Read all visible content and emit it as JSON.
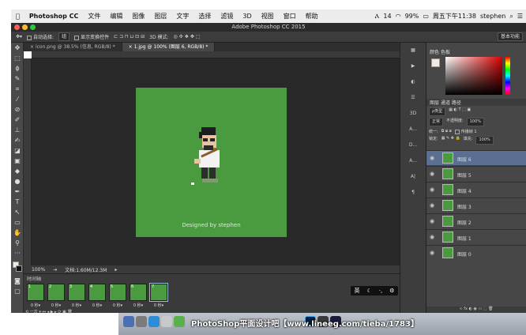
{
  "menubar": {
    "apple": "",
    "app": "Photoshop CC",
    "items": [
      "文件",
      "编辑",
      "图像",
      "图层",
      "文字",
      "选择",
      "滤镜",
      "3D",
      "视图",
      "窗口",
      "帮助"
    ],
    "status_a": "14",
    "battery": "99%",
    "clock": "周五下午11:38",
    "user": "stephen"
  },
  "titlebar": {
    "title": "Adobe Photoshop CC 2015"
  },
  "options": {
    "auto_select": "自动选择:",
    "auto_select_value": "组",
    "show_transform": "显示变换控件",
    "mode3d": "3D 模式:",
    "workspace": "基本功能"
  },
  "tabs": [
    {
      "label": "icon.png @ 38.5% (信息, RGB/8) *"
    },
    {
      "label": "1.jpg @ 100% (图层 6, RGB/8) *"
    }
  ],
  "canvas": {
    "credit": "Designed by stephen"
  },
  "status": {
    "zoom": "100%",
    "doc": "文档:1.60M/12.3M"
  },
  "timeline": {
    "title": "时间轴",
    "frames": [
      {
        "num": "1",
        "delay": "0 秒▾"
      },
      {
        "num": "2",
        "delay": "0 秒▾"
      },
      {
        "num": "3",
        "delay": "0 秒▾"
      },
      {
        "num": "4",
        "delay": "0 秒▾"
      },
      {
        "num": "5",
        "delay": "0 秒▾"
      },
      {
        "num": "6",
        "delay": "0 秒▾"
      },
      {
        "num": "7",
        "delay": "0 秒▾"
      }
    ],
    "loop": "一次"
  },
  "dockstrip": [
    "3D",
    "A...",
    "D...",
    "A..."
  ],
  "rpanel": {
    "color_tab": "颜色",
    "swatch_tab": "色板",
    "layer_tabs": [
      "图层",
      "通道",
      "路径"
    ],
    "filter": "ρ类型",
    "blend": "正常",
    "opacity_label": "不透明度:",
    "opacity": "100%",
    "unify": "统一:",
    "propagate": "传播帧 1",
    "lock": "锁定:",
    "fill_label": "填充:",
    "fill": "100%",
    "layers": [
      "图层 6",
      "图层 5",
      "图层 4",
      "图层 3",
      "图层 2",
      "图层 1",
      "图层 0"
    ]
  },
  "dock": {
    "watermark": "PhotoShop平面设计吧【www.lineeg.com/tieba/1783】"
  },
  "toast": {
    "a": "英"
  }
}
